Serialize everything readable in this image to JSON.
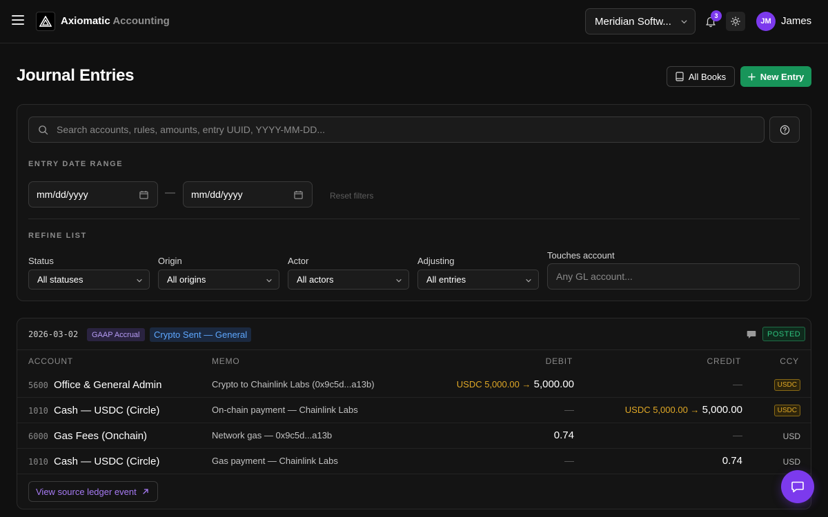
{
  "header": {
    "brand_main": "Axiomatic",
    "brand_sub": "Accounting",
    "company": "Meridian Softw...",
    "notification_count": "3",
    "user_initials": "JM",
    "user_name": "James"
  },
  "page": {
    "title": "Journal Entries",
    "all_books_label": "All Books",
    "new_entry_label": "New Entry"
  },
  "filters": {
    "search_placeholder": "Search accounts, rules, amounts, entry UUID, YYYY-MM-DD...",
    "date_range_label": "ENTRY DATE RANGE",
    "date_from": "mm/dd/yyyy",
    "date_to": "mm/dd/yyyy",
    "date_separator": "—",
    "reset_label": "Reset filters",
    "refine_label": "REFINE LIST",
    "status": {
      "label": "Status",
      "value": "All statuses"
    },
    "origin": {
      "label": "Origin",
      "value": "All origins"
    },
    "actor": {
      "label": "Actor",
      "value": "All actors"
    },
    "adjusting": {
      "label": "Adjusting",
      "value": "All entries"
    },
    "touches_account": {
      "label": "Touches account",
      "placeholder": "Any GL account..."
    }
  },
  "entry": {
    "date": "2026-03-02",
    "tag": "GAAP Accrual",
    "rule": "Crypto Sent — General",
    "status": "POSTED",
    "columns": {
      "account": "ACCOUNT",
      "memo": "MEMO",
      "debit": "DEBIT",
      "credit": "CREDIT",
      "ccy": "CCY"
    },
    "lines": [
      {
        "code": "5600",
        "account": "Office & General Admin",
        "memo": "Crypto to Chainlink Labs (0x9c5d...a13b)",
        "debit_fx": "USDC 5,000.00 →",
        "debit": "5,000.00",
        "credit": "—",
        "ccy": "USDC"
      },
      {
        "code": "1010",
        "account": "Cash — USDC (Circle)",
        "memo": "On-chain payment — Chainlink Labs",
        "debit": "—",
        "credit_fx": "USDC 5,000.00 →",
        "credit": "5,000.00",
        "ccy": "USDC"
      },
      {
        "code": "6000",
        "account": "Gas Fees (Onchain)",
        "memo": "Network gas — 0x9c5d...a13b",
        "debit": "0.74",
        "credit": "—",
        "ccy": "USD"
      },
      {
        "code": "1010",
        "account": "Cash — USDC (Circle)",
        "memo": "Gas payment — Chainlink Labs",
        "debit": "—",
        "credit": "0.74",
        "ccy": "USD"
      }
    ],
    "source_link": "View source ledger event"
  },
  "icons": {
    "menu": "menu-icon",
    "logo": "axiomatic-logo-icon",
    "bell": "bell-icon",
    "theme": "sun-icon",
    "search": "search-icon",
    "help": "help-circle-icon",
    "calendar": "calendar-icon",
    "book": "book-icon",
    "plus": "plus-icon",
    "comment": "comment-icon",
    "external": "arrow-up-right-icon",
    "chat": "chat-icon"
  },
  "colors": {
    "accent": "#7c3aed",
    "primary_button": "#18955a",
    "posted": "#2ec27e",
    "fx_amount": "#e0a826",
    "rule_link": "#5ea8ff"
  }
}
